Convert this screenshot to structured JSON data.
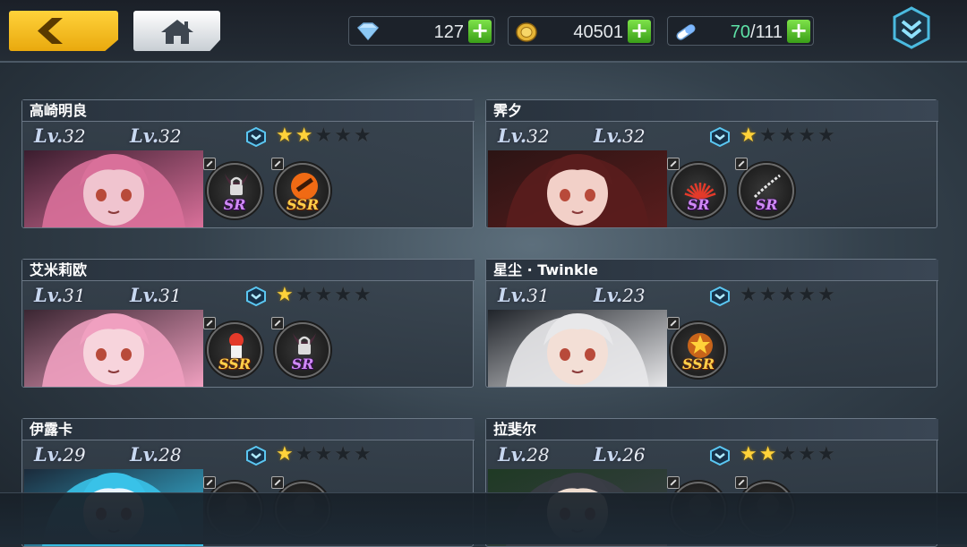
{
  "resources": {
    "gems": "127",
    "gold": "40501",
    "stamina_current": "70",
    "stamina_max": "/111",
    "plus": "+"
  },
  "level_mark": "Lv.",
  "characters": [
    {
      "name": "高崎明良",
      "lv1": "32",
      "lv2": "32",
      "stars": 2,
      "equips": [
        {
          "rarity": "SR",
          "locked": true,
          "icon": "horn-lock-icon"
        },
        {
          "rarity": "SSR",
          "locked": false,
          "icon": "guitar-icon"
        }
      ]
    },
    {
      "name": "霁夕",
      "lv1": "32",
      "lv2": "32",
      "stars": 1,
      "equips": [
        {
          "rarity": "SR",
          "locked": false,
          "icon": "fan-icon"
        },
        {
          "rarity": "SR",
          "locked": false,
          "icon": "chain-icon"
        }
      ]
    },
    {
      "name": "艾米莉欧",
      "lv1": "31",
      "lv2": "31",
      "stars": 1,
      "equips": [
        {
          "rarity": "SSR",
          "locked": false,
          "icon": "figure-icon"
        },
        {
          "rarity": "SR",
          "locked": true,
          "icon": "horn-lock-icon"
        }
      ]
    },
    {
      "name": "星尘 · Twinkle",
      "lv1": "31",
      "lv2": "23",
      "stars": 0,
      "equips": [
        {
          "rarity": "SSR",
          "locked": false,
          "icon": "star-orb-icon"
        }
      ]
    },
    {
      "name": "伊露卡",
      "lv1": "29",
      "lv2": "28",
      "stars": 1,
      "equips": [
        {
          "rarity": "",
          "locked": false,
          "icon": "equip-icon"
        },
        {
          "rarity": "",
          "locked": false,
          "icon": "equip-icon"
        }
      ]
    },
    {
      "name": "拉斐尔",
      "lv1": "28",
      "lv2": "26",
      "stars": 2,
      "equips": [
        {
          "rarity": "",
          "locked": false,
          "icon": "equip-icon"
        },
        {
          "rarity": "",
          "locked": false,
          "icon": "equip-icon"
        }
      ]
    }
  ],
  "colors": {
    "accent": "#ffd23a",
    "plus_green": "#4cc02a",
    "stamina": "#5ee2a6",
    "ssr": "#ffcf4a",
    "sr": "#d08af6"
  }
}
